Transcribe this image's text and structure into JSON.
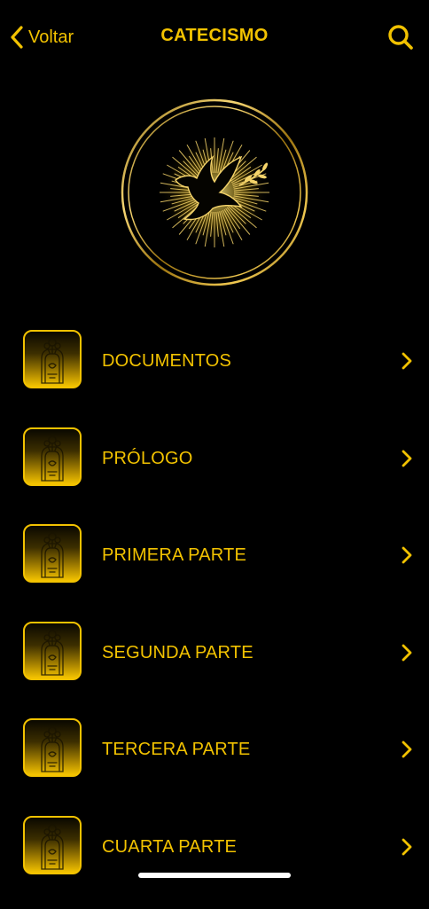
{
  "nav": {
    "back_label": "Voltar",
    "title": "CATECISMO",
    "back_icon": "chevron-left-icon",
    "search_icon": "search-icon"
  },
  "emblem": {
    "icon": "dove-icon"
  },
  "menu": {
    "items": [
      {
        "label": "DOCUMENTOS"
      },
      {
        "label": "PRÓLOGO"
      },
      {
        "label": "PRIMERA PARTE"
      },
      {
        "label": "SEGUNDA PARTE"
      },
      {
        "label": "TERCERA PARTE"
      },
      {
        "label": "CUARTA PARTE"
      }
    ],
    "item_icon": "chevron-right-icon",
    "thumb_icon": "vase-icon"
  },
  "colors": {
    "background": "#000000",
    "accent": "#F2C200"
  }
}
